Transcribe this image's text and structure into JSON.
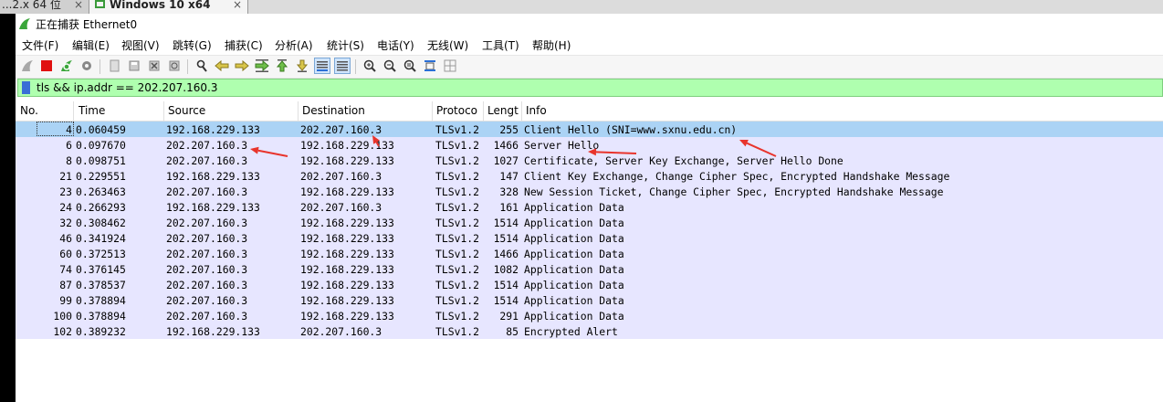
{
  "vm_tabs": [
    {
      "label": "...2.x 64 位",
      "close": "×"
    },
    {
      "label": "Windows 10 x64",
      "close": "×"
    }
  ],
  "window": {
    "title": "正在捕获 Ethernet0"
  },
  "menu": [
    "文件(F)",
    "编辑(E)",
    "视图(V)",
    "跳转(G)",
    "捕获(C)",
    "分析(A)",
    "统计(S)",
    "电话(Y)",
    "无线(W)",
    "工具(T)",
    "帮助(H)"
  ],
  "toolbar": {
    "icons": [
      "shark-fin-start-icon",
      "stop-square-icon",
      "restart-icon",
      "capture-options-icon",
      "open-file-icon",
      "save-file-icon",
      "close-file-icon",
      "reload-icon",
      "find-packet-icon",
      "go-back-icon",
      "go-forward-icon",
      "go-to-packet-icon",
      "go-first-icon",
      "go-last-icon",
      "autoscroll-icon",
      "colorize-icon",
      "zoom-in-icon",
      "zoom-out-icon",
      "zoom-normal-icon",
      "resize-columns-icon",
      "layout-icon"
    ]
  },
  "filter": {
    "value": "tls && ip.addr == 202.207.160.3"
  },
  "columns": [
    "No.",
    "Time",
    "Source",
    "Destination",
    "Protoco",
    "Lengt",
    "Info"
  ],
  "packets": [
    {
      "no": "4",
      "time": "0.060459",
      "src": "192.168.229.133",
      "dst": "202.207.160.3",
      "proto": "TLSv1.2",
      "len": "255",
      "info": "Client Hello (SNI=www.sxnu.edu.cn)"
    },
    {
      "no": "6",
      "time": "0.097670",
      "src": "202.207.160.3",
      "dst": "192.168.229.133",
      "proto": "TLSv1.2",
      "len": "1466",
      "info": "Server Hello"
    },
    {
      "no": "8",
      "time": "0.098751",
      "src": "202.207.160.3",
      "dst": "192.168.229.133",
      "proto": "TLSv1.2",
      "len": "1027",
      "info": "Certificate, Server Key Exchange, Server Hello Done"
    },
    {
      "no": "21",
      "time": "0.229551",
      "src": "192.168.229.133",
      "dst": "202.207.160.3",
      "proto": "TLSv1.2",
      "len": "147",
      "info": "Client Key Exchange, Change Cipher Spec, Encrypted Handshake Message"
    },
    {
      "no": "23",
      "time": "0.263463",
      "src": "202.207.160.3",
      "dst": "192.168.229.133",
      "proto": "TLSv1.2",
      "len": "328",
      "info": "New Session Ticket, Change Cipher Spec, Encrypted Handshake Message"
    },
    {
      "no": "24",
      "time": "0.266293",
      "src": "192.168.229.133",
      "dst": "202.207.160.3",
      "proto": "TLSv1.2",
      "len": "161",
      "info": "Application Data"
    },
    {
      "no": "32",
      "time": "0.308462",
      "src": "202.207.160.3",
      "dst": "192.168.229.133",
      "proto": "TLSv1.2",
      "len": "1514",
      "info": "Application Data"
    },
    {
      "no": "46",
      "time": "0.341924",
      "src": "202.207.160.3",
      "dst": "192.168.229.133",
      "proto": "TLSv1.2",
      "len": "1514",
      "info": "Application Data"
    },
    {
      "no": "60",
      "time": "0.372513",
      "src": "202.207.160.3",
      "dst": "192.168.229.133",
      "proto": "TLSv1.2",
      "len": "1466",
      "info": "Application Data"
    },
    {
      "no": "74",
      "time": "0.376145",
      "src": "202.207.160.3",
      "dst": "192.168.229.133",
      "proto": "TLSv1.2",
      "len": "1082",
      "info": "Application Data"
    },
    {
      "no": "87",
      "time": "0.378537",
      "src": "202.207.160.3",
      "dst": "192.168.229.133",
      "proto": "TLSv1.2",
      "len": "1514",
      "info": "Application Data"
    },
    {
      "no": "99",
      "time": "0.378894",
      "src": "202.207.160.3",
      "dst": "192.168.229.133",
      "proto": "TLSv1.2",
      "len": "1514",
      "info": "Application Data"
    },
    {
      "no": "100",
      "time": "0.378894",
      "src": "202.207.160.3",
      "dst": "192.168.229.133",
      "proto": "TLSv1.2",
      "len": "291",
      "info": "Application Data"
    },
    {
      "no": "102",
      "time": "0.389232",
      "src": "192.168.229.133",
      "dst": "202.207.160.3",
      "proto": "TLSv1.2",
      "len": "85",
      "info": "Encrypted Alert"
    }
  ],
  "selected_index": 0,
  "colors": {
    "row_bg": "#e7e6ff",
    "selected_bg": "#abd3f5",
    "filter_bg": "#afffaf",
    "annotation_arrow": "#e8342c"
  }
}
